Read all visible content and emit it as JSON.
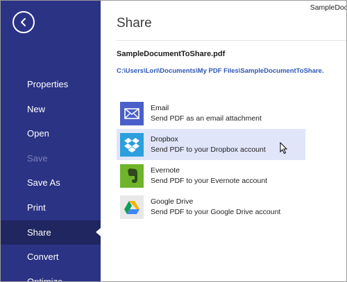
{
  "window_title": "SampleDoc",
  "sidebar": {
    "items": [
      {
        "label": "Properties"
      },
      {
        "label": "New"
      },
      {
        "label": "Open"
      },
      {
        "label": "Save"
      },
      {
        "label": "Save As"
      },
      {
        "label": "Print"
      },
      {
        "label": "Share"
      },
      {
        "label": "Convert"
      },
      {
        "label": "Optimize"
      }
    ],
    "active": "Share",
    "disabled": [
      "Save"
    ]
  },
  "page": {
    "title": "Share",
    "document_name": "SampleDocumentToShare.pdf",
    "document_path": "C:\\Users\\Lori\\Documents\\My PDF Files\\SampleDocumentToShare."
  },
  "share_options": [
    {
      "name": "Email",
      "description": "Send PDF as an email attachment",
      "icon": "email-icon",
      "color": "#4a5fc9"
    },
    {
      "name": "Dropbox",
      "description": "Send PDF to your Dropbox account",
      "icon": "dropbox-icon",
      "color": "#2c9fdd"
    },
    {
      "name": "Evernote",
      "description": "Send PDF to your Evernote account",
      "icon": "evernote-icon",
      "color": "#6fb52c"
    },
    {
      "name": "Google Drive",
      "description": "Send PDF to your Google Drive account",
      "icon": "google-drive-icon",
      "color": "#e8e8e8"
    }
  ],
  "hovered_option": "Dropbox",
  "colors": {
    "sidebar_bg": "#2b3385",
    "sidebar_active": "#20265f",
    "hover_bg": "#e0e5fa",
    "link": "#2d56b7"
  }
}
